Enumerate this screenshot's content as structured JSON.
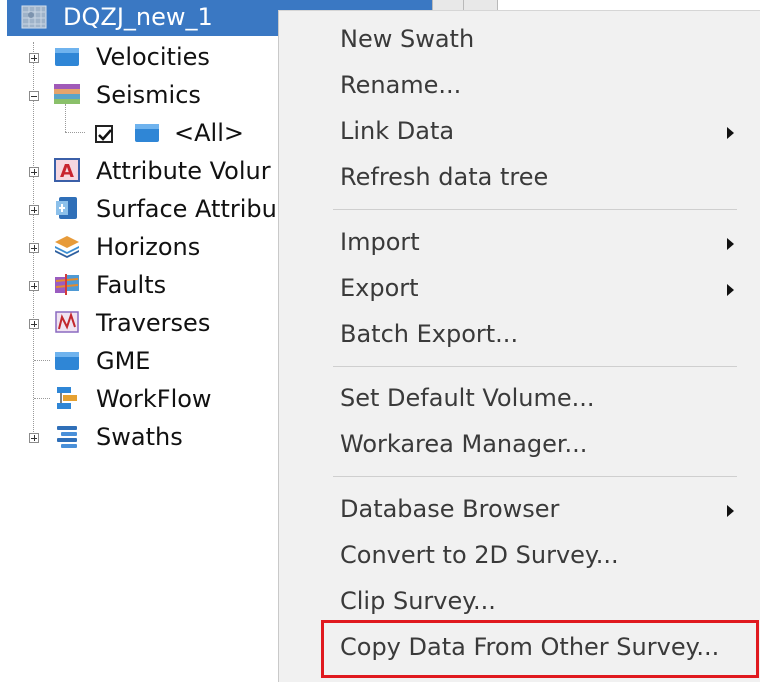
{
  "tree": {
    "root": {
      "label": "DQZJ_new_1",
      "icon": "workarea-icon"
    },
    "items": [
      {
        "label": "Velocities",
        "icon": "folder-icon",
        "expander": "plus"
      },
      {
        "label": "Seismics",
        "icon": "seismic-icon",
        "expander": "minus"
      },
      {
        "label": "<All>",
        "icon": "folder-icon",
        "checked": true
      },
      {
        "label": "Attribute Volur",
        "icon": "attribute-volume-icon",
        "expander": "plus"
      },
      {
        "label": "Surface Attribu",
        "icon": "surface-attribute-icon",
        "expander": "plus"
      },
      {
        "label": "Horizons",
        "icon": "horizons-icon",
        "expander": "plus"
      },
      {
        "label": "Faults",
        "icon": "faults-icon",
        "expander": "plus"
      },
      {
        "label": "Traverses",
        "icon": "traverses-icon",
        "expander": "plus"
      },
      {
        "label": "GME",
        "icon": "folder-icon"
      },
      {
        "label": "WorkFlow",
        "icon": "workflow-icon"
      },
      {
        "label": "Swaths",
        "icon": "swaths-icon",
        "expander": "plus"
      }
    ]
  },
  "menu": {
    "groups": [
      [
        {
          "label": "New Swath",
          "submenu": false
        },
        {
          "label": "Rename...",
          "submenu": false
        },
        {
          "label": "Link Data",
          "submenu": true
        },
        {
          "label": "Refresh data tree",
          "submenu": false
        }
      ],
      [
        {
          "label": "Import",
          "submenu": true
        },
        {
          "label": "Export",
          "submenu": true
        },
        {
          "label": "Batch Export...",
          "submenu": false
        }
      ],
      [
        {
          "label": "Set Default Volume...",
          "submenu": false
        },
        {
          "label": "Workarea Manager...",
          "submenu": false
        }
      ],
      [
        {
          "label": "Database Browser",
          "submenu": true
        },
        {
          "label": "Convert to 2D Survey...",
          "submenu": false
        },
        {
          "label": "Clip Survey...",
          "submenu": false
        },
        {
          "label": "Copy Data From Other Survey...",
          "submenu": false
        }
      ]
    ]
  },
  "colors": {
    "selection": "#3a78c3",
    "highlight": "#e0191f",
    "menu_bg": "#f1f1f1"
  }
}
